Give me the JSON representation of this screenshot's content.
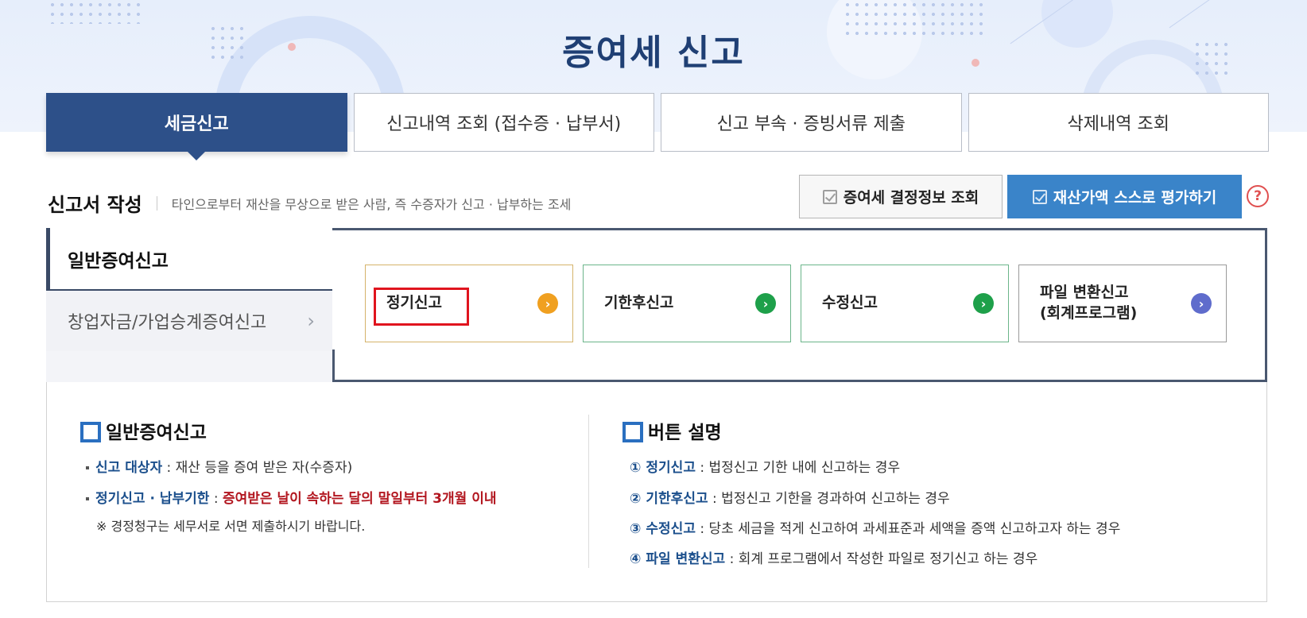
{
  "page_title": "증여세 신고",
  "tabs": [
    {
      "label": "세금신고",
      "active": true
    },
    {
      "label": "신고내역 조회 (접수증 · 납부서)",
      "active": false
    },
    {
      "label": "신고 부속 · 증빙서류 제출",
      "active": false
    },
    {
      "label": "삭제내역 조회",
      "active": false
    }
  ],
  "section": {
    "title": "신고서 작성",
    "description": "타인으로부터 재산을 무상으로 받은 사람, 즉 수증자가 신고 · 납부하는 조세"
  },
  "buttons": {
    "decision_info": "증여세 결정정보 조회",
    "self_assess": "재산가액 스스로 평가하기",
    "help": "?"
  },
  "left_menu": [
    {
      "label": "일반증여신고",
      "selected": true
    },
    {
      "label": "창업자금/가업승계증여신고",
      "selected": false,
      "arrow": "›"
    }
  ],
  "report_buttons": [
    {
      "label": "정기신고",
      "accent": "#f0a020",
      "go": "›"
    },
    {
      "label": "기한후신고",
      "accent": "#1ea04a",
      "go": "›"
    },
    {
      "label": "수정신고",
      "accent": "#1ea04a",
      "go": "›"
    },
    {
      "label": "파일 변환신고",
      "label2": "(회계프로그램)",
      "accent": "#5f6ccc",
      "go": "›"
    }
  ],
  "info_left": {
    "title": "일반증여신고",
    "line1_key": "신고 대상자",
    "line1_val": " : 재산 등을 증여 받은 자(수증자)",
    "line2_key": "정기신고 · 납부기한",
    "line2_sep": " : ",
    "line2_val": "증여받은 날이 속하는 달의 말일부터 3개월 이내",
    "note": "※  경정청구는 세무서로 서면 제출하시기 바랍니다."
  },
  "info_right": {
    "title": "버튼 설명",
    "items": [
      {
        "num": "①",
        "key": "정기신고",
        "val": " : 법정신고 기한 내에 신고하는 경우"
      },
      {
        "num": "②",
        "key": "기한후신고",
        "val": " : 법정신고 기한을 경과하여 신고하는 경우"
      },
      {
        "num": "③",
        "key": "수정신고",
        "val": " : 당초 세금을 적게 신고하여 과세표준과 세액을 증액 신고하고자 하는 경우"
      },
      {
        "num": "④",
        "key": "파일 변환신고",
        "val": " : 회계 프로그램에서 작성한 파일로 정기신고 하는 경우"
      }
    ]
  },
  "colors": {
    "brand_navy": "#2d5089",
    "accent_blue": "#3a84c9",
    "highlight_red": "#e0141e"
  }
}
